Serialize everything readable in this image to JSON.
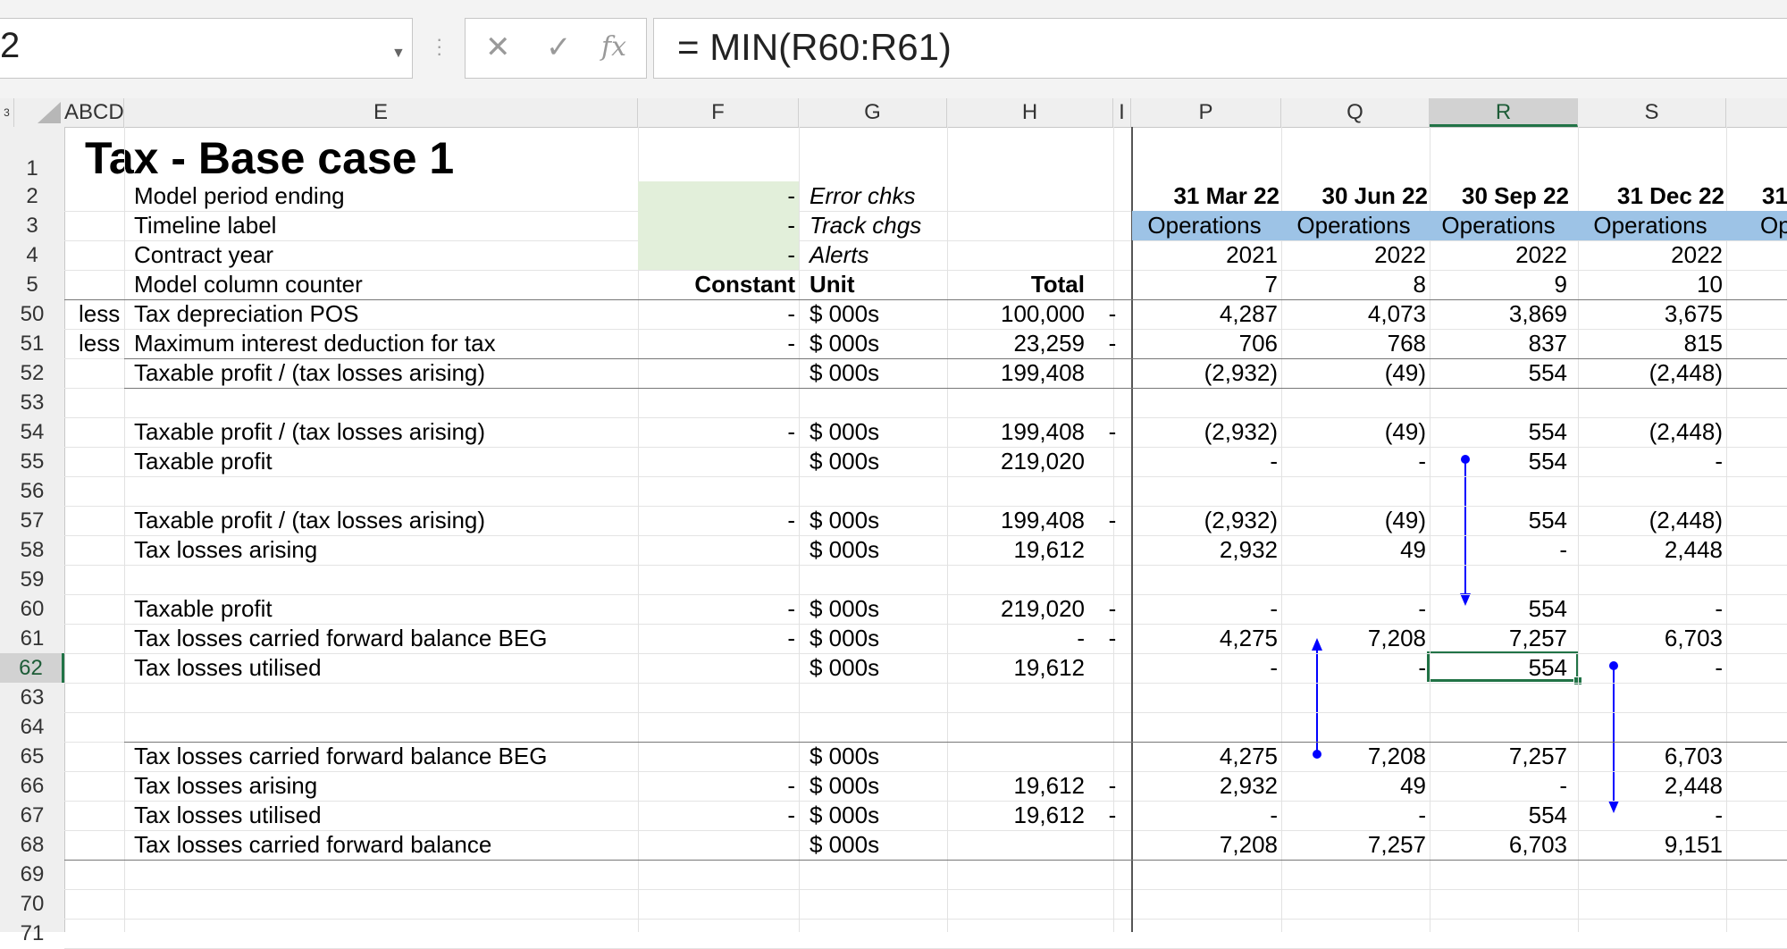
{
  "name_box": {
    "value": "2"
  },
  "formula_bar": {
    "cancel": "✕",
    "enter": "✓",
    "fx": "fx",
    "formula": "= MIN(R60:R61)"
  },
  "columns": {
    "corner_left": "3",
    "abcd": "ABCD",
    "e": "E",
    "f": "F",
    "g": "G",
    "h": "H",
    "i": "I",
    "p": "P",
    "q": "Q",
    "r": "R",
    "s": "S"
  },
  "rows": [
    "1",
    "2",
    "3",
    "4",
    "5",
    "50",
    "51",
    "52",
    "53",
    "54",
    "55",
    "56",
    "57",
    "58",
    "59",
    "60",
    "61",
    "62",
    "63",
    "64",
    "65",
    "66",
    "67",
    "68",
    "69",
    "70",
    "71"
  ],
  "sheet": {
    "title": "Tax - Base case 1",
    "header_labels": {
      "r2": "Model period ending",
      "r3": "Timeline label",
      "r4": "Contract year",
      "r5": "Model column counter",
      "f2": "-",
      "f3": "-",
      "f4": "-",
      "f5": "Constant",
      "g2": "Error chks",
      "g3": "Track chgs",
      "g4": "Alerts",
      "g5": "Unit",
      "h5": "Total"
    },
    "periods": {
      "dates": [
        "31 Mar 22",
        "30 Jun 22",
        "30 Sep 22",
        "31 Dec 22",
        "31"
      ],
      "labels": [
        "Operations",
        "Operations",
        "Operations",
        "Operations",
        "Op"
      ],
      "years": [
        "2021",
        "2022",
        "2022",
        "2022"
      ],
      "counters": [
        "7",
        "8",
        "9",
        "10"
      ]
    },
    "data_rows": [
      {
        "row": "50",
        "prefix": "less",
        "label": "Tax depreciation POS",
        "f": "-",
        "unit": "$ 000s",
        "total": "100,000",
        "i": "-",
        "p": "4,287",
        "q": "4,073",
        "r": "3,869",
        "s": "3,675"
      },
      {
        "row": "51",
        "prefix": "less",
        "label": "Maximum interest deduction for tax",
        "f": "-",
        "unit": "$ 000s",
        "total": "23,259",
        "i": "-",
        "p": "706",
        "q": "768",
        "r": "837",
        "s": "815"
      },
      {
        "row": "52",
        "prefix": "",
        "label": "Taxable profit / (tax losses arising)",
        "f": "",
        "unit": "$ 000s",
        "total": "199,408",
        "i": "",
        "p": "(2,932)",
        "q": "(49)",
        "r": "554",
        "s": "(2,448)"
      },
      {
        "row": "54",
        "prefix": "",
        "label": "Taxable profit / (tax losses arising)",
        "f": "-",
        "unit": "$ 000s",
        "total": "199,408",
        "i": "-",
        "p": "(2,932)",
        "q": "(49)",
        "r": "554",
        "s": "(2,448)"
      },
      {
        "row": "55",
        "prefix": "",
        "label": "Taxable profit",
        "f": "",
        "unit": "$ 000s",
        "total": "219,020",
        "i": "",
        "p": "-",
        "q": "-",
        "r": "554",
        "s": "-"
      },
      {
        "row": "57",
        "prefix": "",
        "label": "Taxable profit / (tax losses arising)",
        "f": "-",
        "unit": "$ 000s",
        "total": "199,408",
        "i": "-",
        "p": "(2,932)",
        "q": "(49)",
        "r": "554",
        "s": "(2,448)"
      },
      {
        "row": "58",
        "prefix": "",
        "label": "Tax losses arising",
        "f": "",
        "unit": "$ 000s",
        "total": "19,612",
        "i": "",
        "p": "2,932",
        "q": "49",
        "r": "-",
        "s": "2,448"
      },
      {
        "row": "60",
        "prefix": "",
        "label": "Taxable profit",
        "f": "-",
        "unit": "$ 000s",
        "total": "219,020",
        "i": "-",
        "p": "-",
        "q": "-",
        "r": "554",
        "s": "-"
      },
      {
        "row": "61",
        "prefix": "",
        "label": "Tax losses carried forward balance BEG",
        "f": "-",
        "unit": "$ 000s",
        "total": "-",
        "i": "-",
        "p": "4,275",
        "q": "7,208",
        "r": "7,257",
        "s": "6,703"
      },
      {
        "row": "62",
        "prefix": "",
        "label": "Tax losses utilised",
        "f": "",
        "unit": "$ 000s",
        "total": "19,612",
        "i": "",
        "p": "-",
        "q": "-",
        "r": "554",
        "s": "-"
      },
      {
        "row": "65",
        "prefix": "",
        "label": "Tax losses carried forward balance BEG",
        "f": "",
        "unit": "$ 000s",
        "total": "",
        "i": "",
        "p": "4,275",
        "q": "7,208",
        "r": "7,257",
        "s": "6,703"
      },
      {
        "row": "66",
        "prefix": "",
        "label": "Tax losses arising",
        "f": "-",
        "unit": "$ 000s",
        "total": "19,612",
        "i": "-",
        "p": "2,932",
        "q": "49",
        "r": "-",
        "s": "2,448"
      },
      {
        "row": "67",
        "prefix": "",
        "label": "Tax losses utilised",
        "f": "-",
        "unit": "$ 000s",
        "total": "19,612",
        "i": "-",
        "p": "-",
        "q": "-",
        "r": "554",
        "s": "-"
      },
      {
        "row": "68",
        "prefix": "",
        "label": "Tax losses carried forward balance",
        "f": "",
        "unit": "$ 000s",
        "total": "",
        "i": "",
        "p": "7,208",
        "q": "7,257",
        "r": "6,703",
        "s": "9,151"
      }
    ]
  },
  "colors": {
    "accent_green": "#217346",
    "input_green": "#e2efda",
    "timeline_blue": "#9dc3e6",
    "trace_arrow": "#0000ff"
  }
}
